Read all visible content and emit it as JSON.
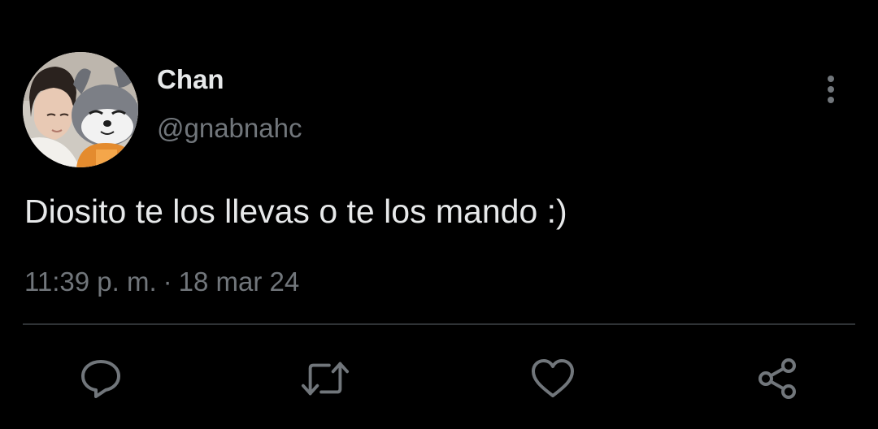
{
  "tweet": {
    "author": {
      "display_name": "Chan",
      "handle": "@gnabnahc",
      "avatar_icon": "profile-avatar"
    },
    "text": "Diosito te los llevas o te los mando :)",
    "time": "11:39 p. m.",
    "separator": "·",
    "date": "18 mar 24",
    "more_icon": "more-vertical-icon"
  },
  "actions": [
    {
      "name": "reply",
      "icon": "reply-icon"
    },
    {
      "name": "retweet",
      "icon": "retweet-icon"
    },
    {
      "name": "like",
      "icon": "heart-icon"
    },
    {
      "name": "share",
      "icon": "share-icon"
    }
  ],
  "colors": {
    "background": "#000000",
    "primary_text": "#e7e9ea",
    "secondary_text": "#71767b",
    "divider": "#2f3336"
  }
}
